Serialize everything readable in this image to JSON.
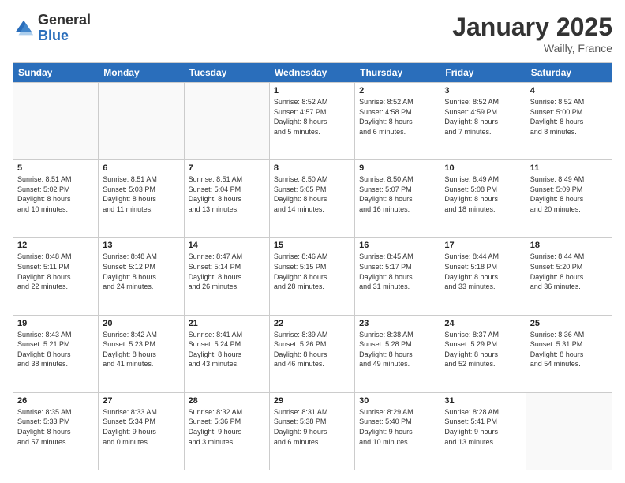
{
  "logo": {
    "general": "General",
    "blue": "Blue"
  },
  "title": "January 2025",
  "location": "Wailly, France",
  "days": [
    "Sunday",
    "Monday",
    "Tuesday",
    "Wednesday",
    "Thursday",
    "Friday",
    "Saturday"
  ],
  "weeks": [
    [
      {
        "day": "",
        "info": ""
      },
      {
        "day": "",
        "info": ""
      },
      {
        "day": "",
        "info": ""
      },
      {
        "day": "1",
        "info": "Sunrise: 8:52 AM\nSunset: 4:57 PM\nDaylight: 8 hours\nand 5 minutes."
      },
      {
        "day": "2",
        "info": "Sunrise: 8:52 AM\nSunset: 4:58 PM\nDaylight: 8 hours\nand 6 minutes."
      },
      {
        "day": "3",
        "info": "Sunrise: 8:52 AM\nSunset: 4:59 PM\nDaylight: 8 hours\nand 7 minutes."
      },
      {
        "day": "4",
        "info": "Sunrise: 8:52 AM\nSunset: 5:00 PM\nDaylight: 8 hours\nand 8 minutes."
      }
    ],
    [
      {
        "day": "5",
        "info": "Sunrise: 8:51 AM\nSunset: 5:02 PM\nDaylight: 8 hours\nand 10 minutes."
      },
      {
        "day": "6",
        "info": "Sunrise: 8:51 AM\nSunset: 5:03 PM\nDaylight: 8 hours\nand 11 minutes."
      },
      {
        "day": "7",
        "info": "Sunrise: 8:51 AM\nSunset: 5:04 PM\nDaylight: 8 hours\nand 13 minutes."
      },
      {
        "day": "8",
        "info": "Sunrise: 8:50 AM\nSunset: 5:05 PM\nDaylight: 8 hours\nand 14 minutes."
      },
      {
        "day": "9",
        "info": "Sunrise: 8:50 AM\nSunset: 5:07 PM\nDaylight: 8 hours\nand 16 minutes."
      },
      {
        "day": "10",
        "info": "Sunrise: 8:49 AM\nSunset: 5:08 PM\nDaylight: 8 hours\nand 18 minutes."
      },
      {
        "day": "11",
        "info": "Sunrise: 8:49 AM\nSunset: 5:09 PM\nDaylight: 8 hours\nand 20 minutes."
      }
    ],
    [
      {
        "day": "12",
        "info": "Sunrise: 8:48 AM\nSunset: 5:11 PM\nDaylight: 8 hours\nand 22 minutes."
      },
      {
        "day": "13",
        "info": "Sunrise: 8:48 AM\nSunset: 5:12 PM\nDaylight: 8 hours\nand 24 minutes."
      },
      {
        "day": "14",
        "info": "Sunrise: 8:47 AM\nSunset: 5:14 PM\nDaylight: 8 hours\nand 26 minutes."
      },
      {
        "day": "15",
        "info": "Sunrise: 8:46 AM\nSunset: 5:15 PM\nDaylight: 8 hours\nand 28 minutes."
      },
      {
        "day": "16",
        "info": "Sunrise: 8:45 AM\nSunset: 5:17 PM\nDaylight: 8 hours\nand 31 minutes."
      },
      {
        "day": "17",
        "info": "Sunrise: 8:44 AM\nSunset: 5:18 PM\nDaylight: 8 hours\nand 33 minutes."
      },
      {
        "day": "18",
        "info": "Sunrise: 8:44 AM\nSunset: 5:20 PM\nDaylight: 8 hours\nand 36 minutes."
      }
    ],
    [
      {
        "day": "19",
        "info": "Sunrise: 8:43 AM\nSunset: 5:21 PM\nDaylight: 8 hours\nand 38 minutes."
      },
      {
        "day": "20",
        "info": "Sunrise: 8:42 AM\nSunset: 5:23 PM\nDaylight: 8 hours\nand 41 minutes."
      },
      {
        "day": "21",
        "info": "Sunrise: 8:41 AM\nSunset: 5:24 PM\nDaylight: 8 hours\nand 43 minutes."
      },
      {
        "day": "22",
        "info": "Sunrise: 8:39 AM\nSunset: 5:26 PM\nDaylight: 8 hours\nand 46 minutes."
      },
      {
        "day": "23",
        "info": "Sunrise: 8:38 AM\nSunset: 5:28 PM\nDaylight: 8 hours\nand 49 minutes."
      },
      {
        "day": "24",
        "info": "Sunrise: 8:37 AM\nSunset: 5:29 PM\nDaylight: 8 hours\nand 52 minutes."
      },
      {
        "day": "25",
        "info": "Sunrise: 8:36 AM\nSunset: 5:31 PM\nDaylight: 8 hours\nand 54 minutes."
      }
    ],
    [
      {
        "day": "26",
        "info": "Sunrise: 8:35 AM\nSunset: 5:33 PM\nDaylight: 8 hours\nand 57 minutes."
      },
      {
        "day": "27",
        "info": "Sunrise: 8:33 AM\nSunset: 5:34 PM\nDaylight: 9 hours\nand 0 minutes."
      },
      {
        "day": "28",
        "info": "Sunrise: 8:32 AM\nSunset: 5:36 PM\nDaylight: 9 hours\nand 3 minutes."
      },
      {
        "day": "29",
        "info": "Sunrise: 8:31 AM\nSunset: 5:38 PM\nDaylight: 9 hours\nand 6 minutes."
      },
      {
        "day": "30",
        "info": "Sunrise: 8:29 AM\nSunset: 5:40 PM\nDaylight: 9 hours\nand 10 minutes."
      },
      {
        "day": "31",
        "info": "Sunrise: 8:28 AM\nSunset: 5:41 PM\nDaylight: 9 hours\nand 13 minutes."
      },
      {
        "day": "",
        "info": ""
      }
    ]
  ]
}
